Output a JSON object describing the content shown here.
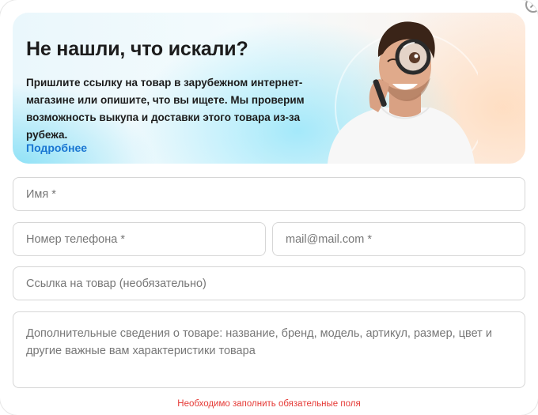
{
  "banner": {
    "title": "Не нашли, что искали?",
    "text": "Пришлите ссылку на товар в зарубежном интернет-магазине или опишите, что вы ищете. Мы проверим возможность выкупа и доставки этого товара из-за рубежа.",
    "link_label": "Подробнее"
  },
  "form": {
    "name_placeholder": "Имя *",
    "phone_placeholder": "Номер телефона *",
    "email_placeholder": "mail@mail.com *",
    "link_placeholder": "Ссылка на товар (необязательно)",
    "details_placeholder": "Дополнительные сведения о товаре: название, бренд, модель, артикул, размер, цвет и другие важные вам характеристики товара"
  },
  "error_message": "Необходимо заполнить обязательные поля",
  "colors": {
    "link": "#1976d2",
    "error": "#e53935",
    "field_border": "#d6d6d6"
  },
  "icons": {
    "close": "close-icon",
    "photo": "man-with-magnifier-photo"
  }
}
